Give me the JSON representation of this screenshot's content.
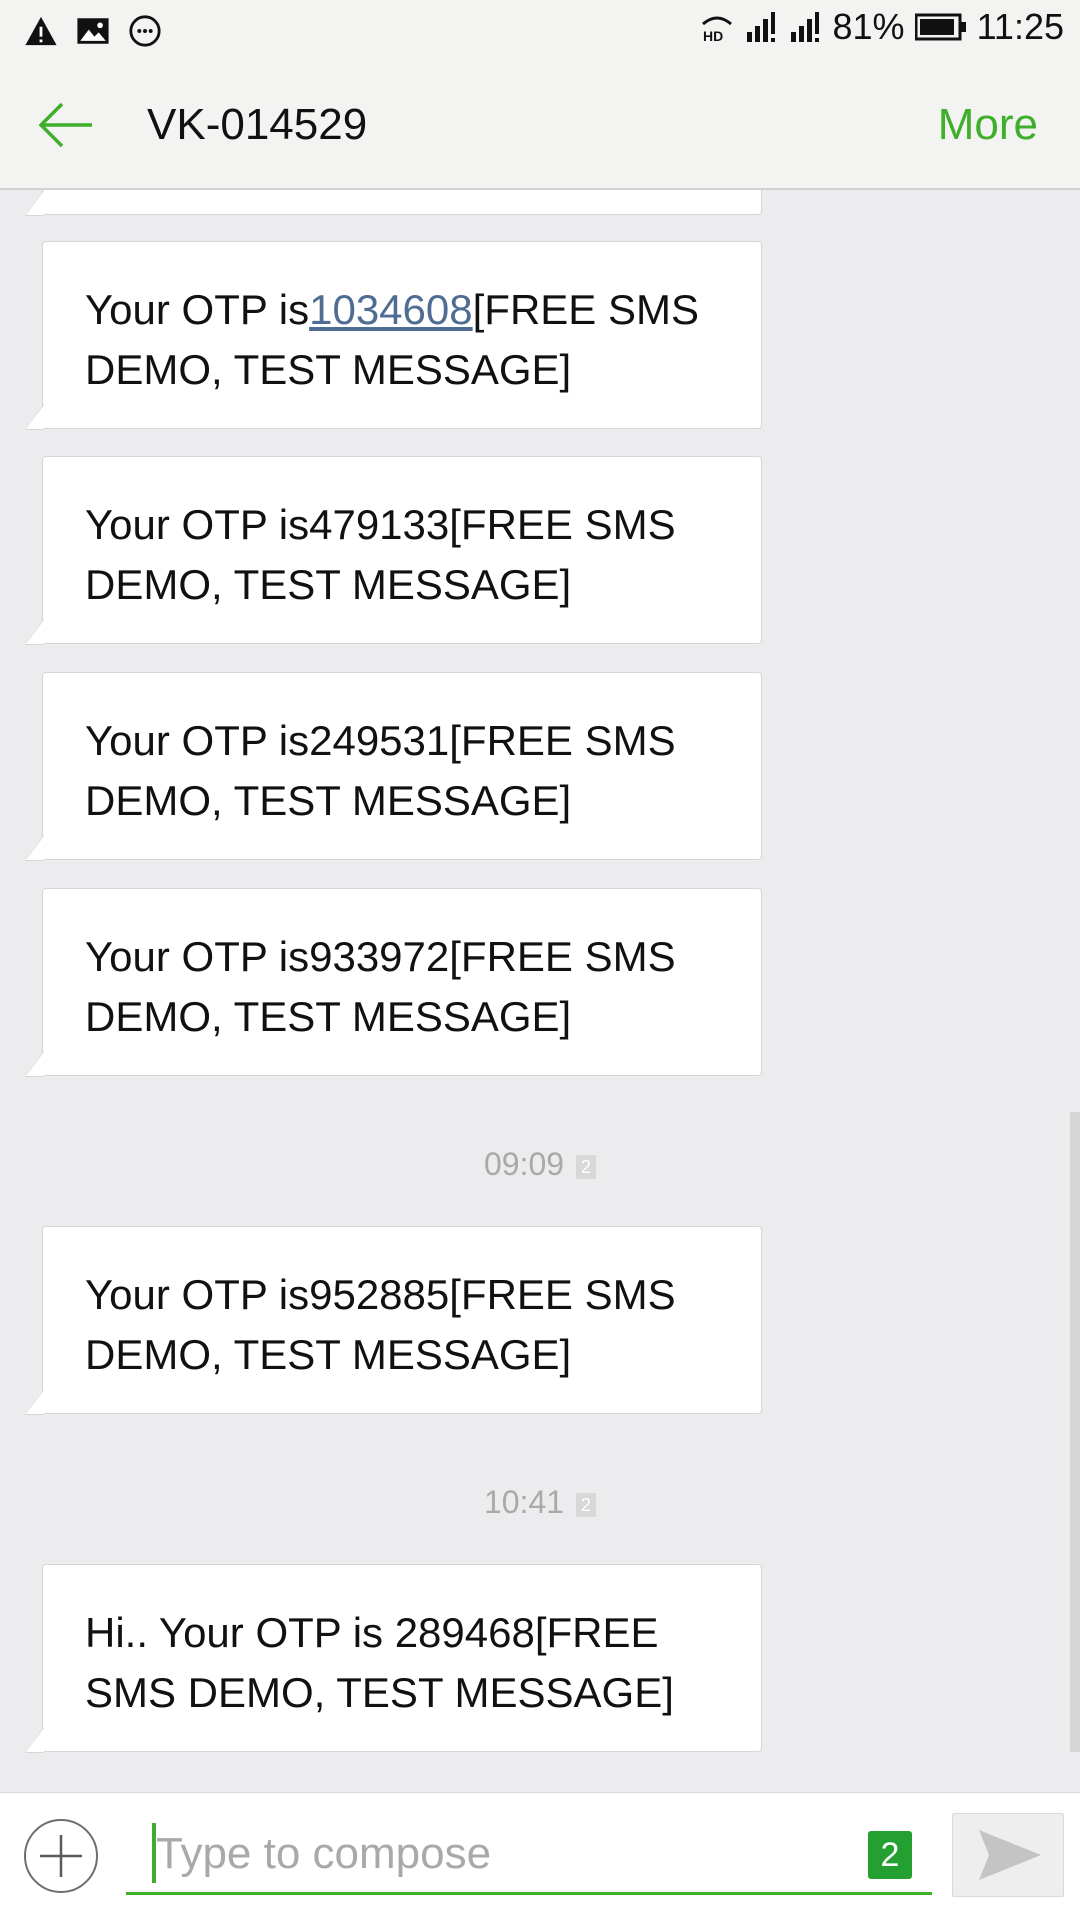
{
  "status_bar": {
    "battery": "81%",
    "time": "11:25",
    "icons": [
      "warning-icon",
      "image-icon",
      "chat-icon",
      "hd-call-icon",
      "signal-icon",
      "signal-icon",
      "battery-icon"
    ]
  },
  "header": {
    "title": "VK-014529",
    "more_label": "More",
    "accent_color": "#3fae2a"
  },
  "messages": [
    {
      "prefix": "Your OTP is",
      "otp": "1034608",
      "suffix": "[FREE SMS DEMO, TEST MESSAGE]"
    },
    {
      "text": "Your OTP is479133[FREE SMS DEMO, TEST MESSAGE]"
    },
    {
      "text": "Your OTP is249531[FREE SMS DEMO, TEST MESSAGE]"
    },
    {
      "text": "Your OTP is933972[FREE SMS DEMO, TEST MESSAGE]"
    },
    {
      "time": "09:09",
      "sim": "2"
    },
    {
      "text": "Your OTP is952885[FREE SMS DEMO, TEST MESSAGE]"
    },
    {
      "time": "10:41",
      "sim": "2"
    },
    {
      "text": "Hi.. Your OTP is 289468[FREE SMS DEMO, TEST MESSAGE]"
    }
  ],
  "compose": {
    "placeholder": "Type to compose",
    "sim": "2"
  }
}
